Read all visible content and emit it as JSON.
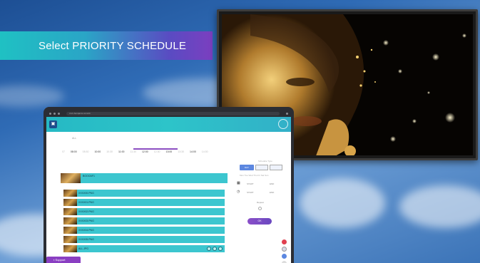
{
  "banner": {
    "title": "Select PRIORITY SCHEDULE"
  },
  "colors": {
    "teal": "#3cc6cf",
    "purple": "#8a3fc2",
    "blue": "#5c87e0"
  },
  "browser": {
    "url": "xxxx.benqams.com/ub"
  },
  "app": {
    "tab_label": "ALL",
    "timeline_ticks": [
      "07",
      "08:00",
      "08:30",
      "10:00",
      "10:30",
      "11:00",
      "11:30",
      "12:00",
      "12:30",
      "13:00",
      "13:30",
      "14:00",
      "14:30"
    ],
    "big_asset": "BOOOAF1",
    "assets": [
      "XXXX00.PNG",
      "XXXX01.PNG",
      "XXXX02.PNG",
      "XXXX03.PNG",
      "XXXX04.PNG",
      "XXXX05.PNG",
      "ALL.JPG"
    ],
    "panel": {
      "header": "Schedule Type",
      "btn_label": "DAY",
      "days": "Mon  Tue  Wed  Thu  Fri  Sat  Sun",
      "date_start": "START",
      "date_end": "END",
      "time_start": "START",
      "time_end": "END",
      "repeat_label": "Repeat",
      "ok_label": "OK"
    }
  },
  "support": {
    "label": "Support"
  }
}
